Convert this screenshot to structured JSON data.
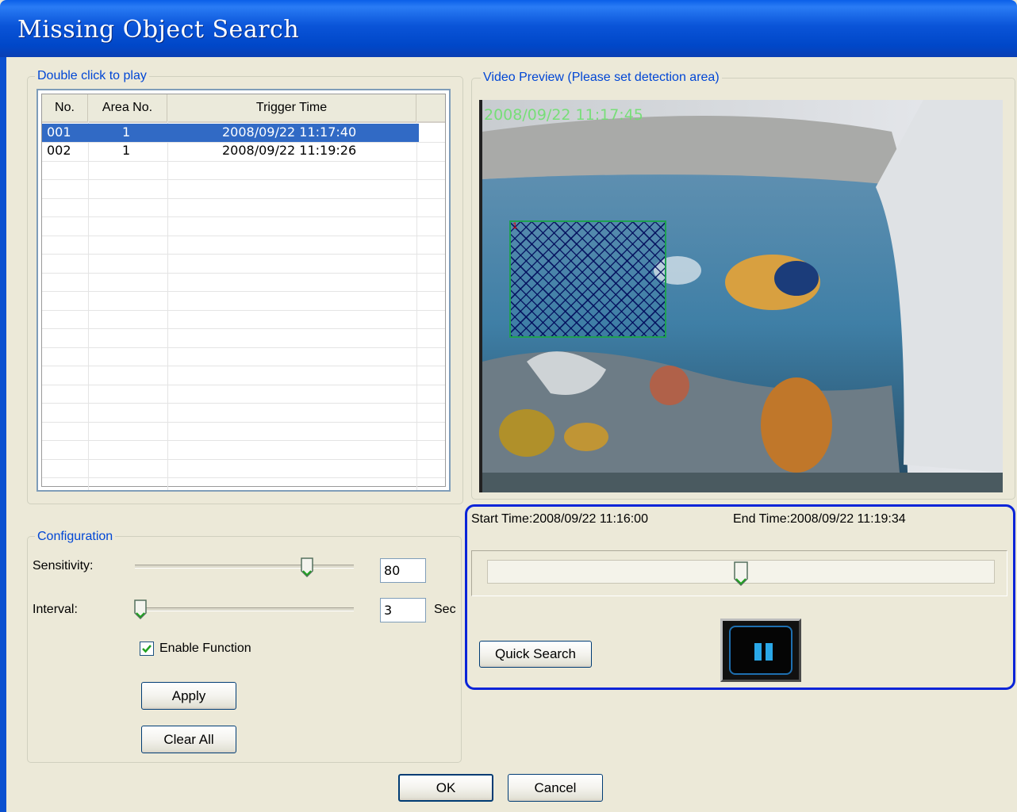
{
  "window": {
    "title": "Missing Object Search"
  },
  "list_group": {
    "legend": "Double click to play",
    "columns": [
      "No.",
      "Area No.",
      "Trigger Time"
    ],
    "rows": [
      {
        "no": "001",
        "area": "1",
        "time": "2008/09/22 11:17:40",
        "selected": true
      },
      {
        "no": "002",
        "area": "1",
        "time": "2008/09/22 11:19:26",
        "selected": false
      }
    ]
  },
  "video_group": {
    "legend": "Video Preview (Please set detection area)",
    "timestamp": "2008/09/22 11:17:45",
    "area_label": "1"
  },
  "playback": {
    "start_time": "Start Time:2008/09/22 11:16:00",
    "end_time": "End Time:2008/09/22 11:19:34",
    "position_fraction": 0.5,
    "quick_search_label": "Quick Search",
    "pause_icon": "pause-icon"
  },
  "config": {
    "legend": "Configuration",
    "sensitivity_label": "Sensitivity:",
    "sensitivity_value": "80",
    "interval_label": "Interval:",
    "interval_value": "3",
    "interval_unit": "Sec",
    "enable_label": "Enable Function",
    "enable_checked": true,
    "apply_label": "Apply",
    "clear_label": "Clear All"
  },
  "footer": {
    "ok_label": "OK",
    "cancel_label": "Cancel"
  },
  "colors": {
    "titlebar": "#0a54d8",
    "selection": "#316ac5",
    "legend_text": "#0046d5",
    "playback_border": "#0a24d8"
  }
}
